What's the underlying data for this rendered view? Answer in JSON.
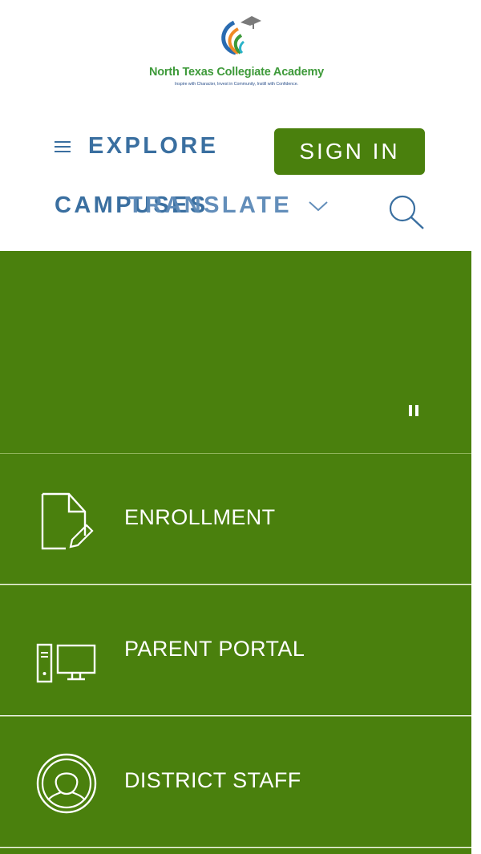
{
  "logo": {
    "name": "North Texas Collegiate Academy",
    "tagline": "Inspire with Character, Invest in Community, Instill with Confidence."
  },
  "nav": {
    "explore_label": "EXPLORE",
    "signin_label": "SIGN IN",
    "campuses_label": "CAMPUSES",
    "translate_label": "TRANSLATE"
  },
  "quick_links": [
    {
      "label": "ENROLLMENT",
      "icon": "document-edit-icon"
    },
    {
      "label": "PARENT PORTAL",
      "icon": "computer-icon"
    },
    {
      "label": "DISTRICT STAFF",
      "icon": "user-circle-icon"
    }
  ],
  "colors": {
    "brand_green": "#4a800d",
    "nav_blue": "#3a6fa0",
    "logo_green": "#3e9a3a"
  }
}
